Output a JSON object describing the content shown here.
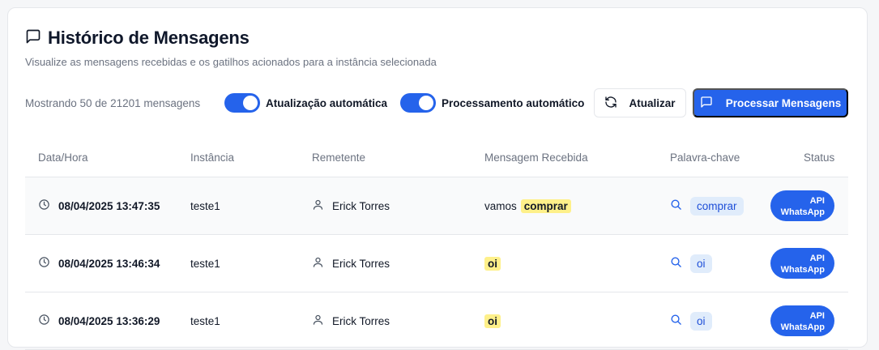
{
  "header": {
    "title": "Histórico de Mensagens",
    "subtitle": "Visualize as mensagens recebidas e os gatilhos acionados para a instância selecionada"
  },
  "toolbar": {
    "count_text": "Mostrando 50 de 21201 mensagens",
    "auto_update_label": "Atualização automática",
    "auto_process_label": "Processamento automático",
    "refresh_label": "Atualizar",
    "process_label": "Processar Mensagens"
  },
  "table": {
    "headers": {
      "datetime": "Data/Hora",
      "instance": "Instância",
      "sender": "Remetente",
      "message": "Mensagem Recebida",
      "keyword": "Palavra-chave",
      "status": "Status"
    },
    "rows": [
      {
        "datetime": "08/04/2025 13:47:35",
        "instance": "teste1",
        "sender": "Erick Torres",
        "message_prefix": "vamos",
        "message_highlight": "comprar",
        "keyword": "comprar",
        "status_line1": "API",
        "status_line2": "WhatsApp"
      },
      {
        "datetime": "08/04/2025 13:46:34",
        "instance": "teste1",
        "sender": "Erick Torres",
        "message_prefix": "",
        "message_highlight": "oi",
        "keyword": "oi",
        "status_line1": "API",
        "status_line2": "WhatsApp"
      },
      {
        "datetime": "08/04/2025 13:36:29",
        "instance": "teste1",
        "sender": "Erick Torres",
        "message_prefix": "",
        "message_highlight": "oi",
        "keyword": "oi",
        "status_line1": "API",
        "status_line2": "WhatsApp"
      }
    ]
  },
  "colors": {
    "primary": "#2563eb",
    "highlight": "#fef08a",
    "keyword_bg": "#e0ecfb"
  },
  "icons": {
    "title": "message-square-icon",
    "refresh": "refresh-icon",
    "process": "message-square-icon",
    "time": "clock-icon",
    "sender": "user-icon",
    "keyword": "search-icon"
  }
}
